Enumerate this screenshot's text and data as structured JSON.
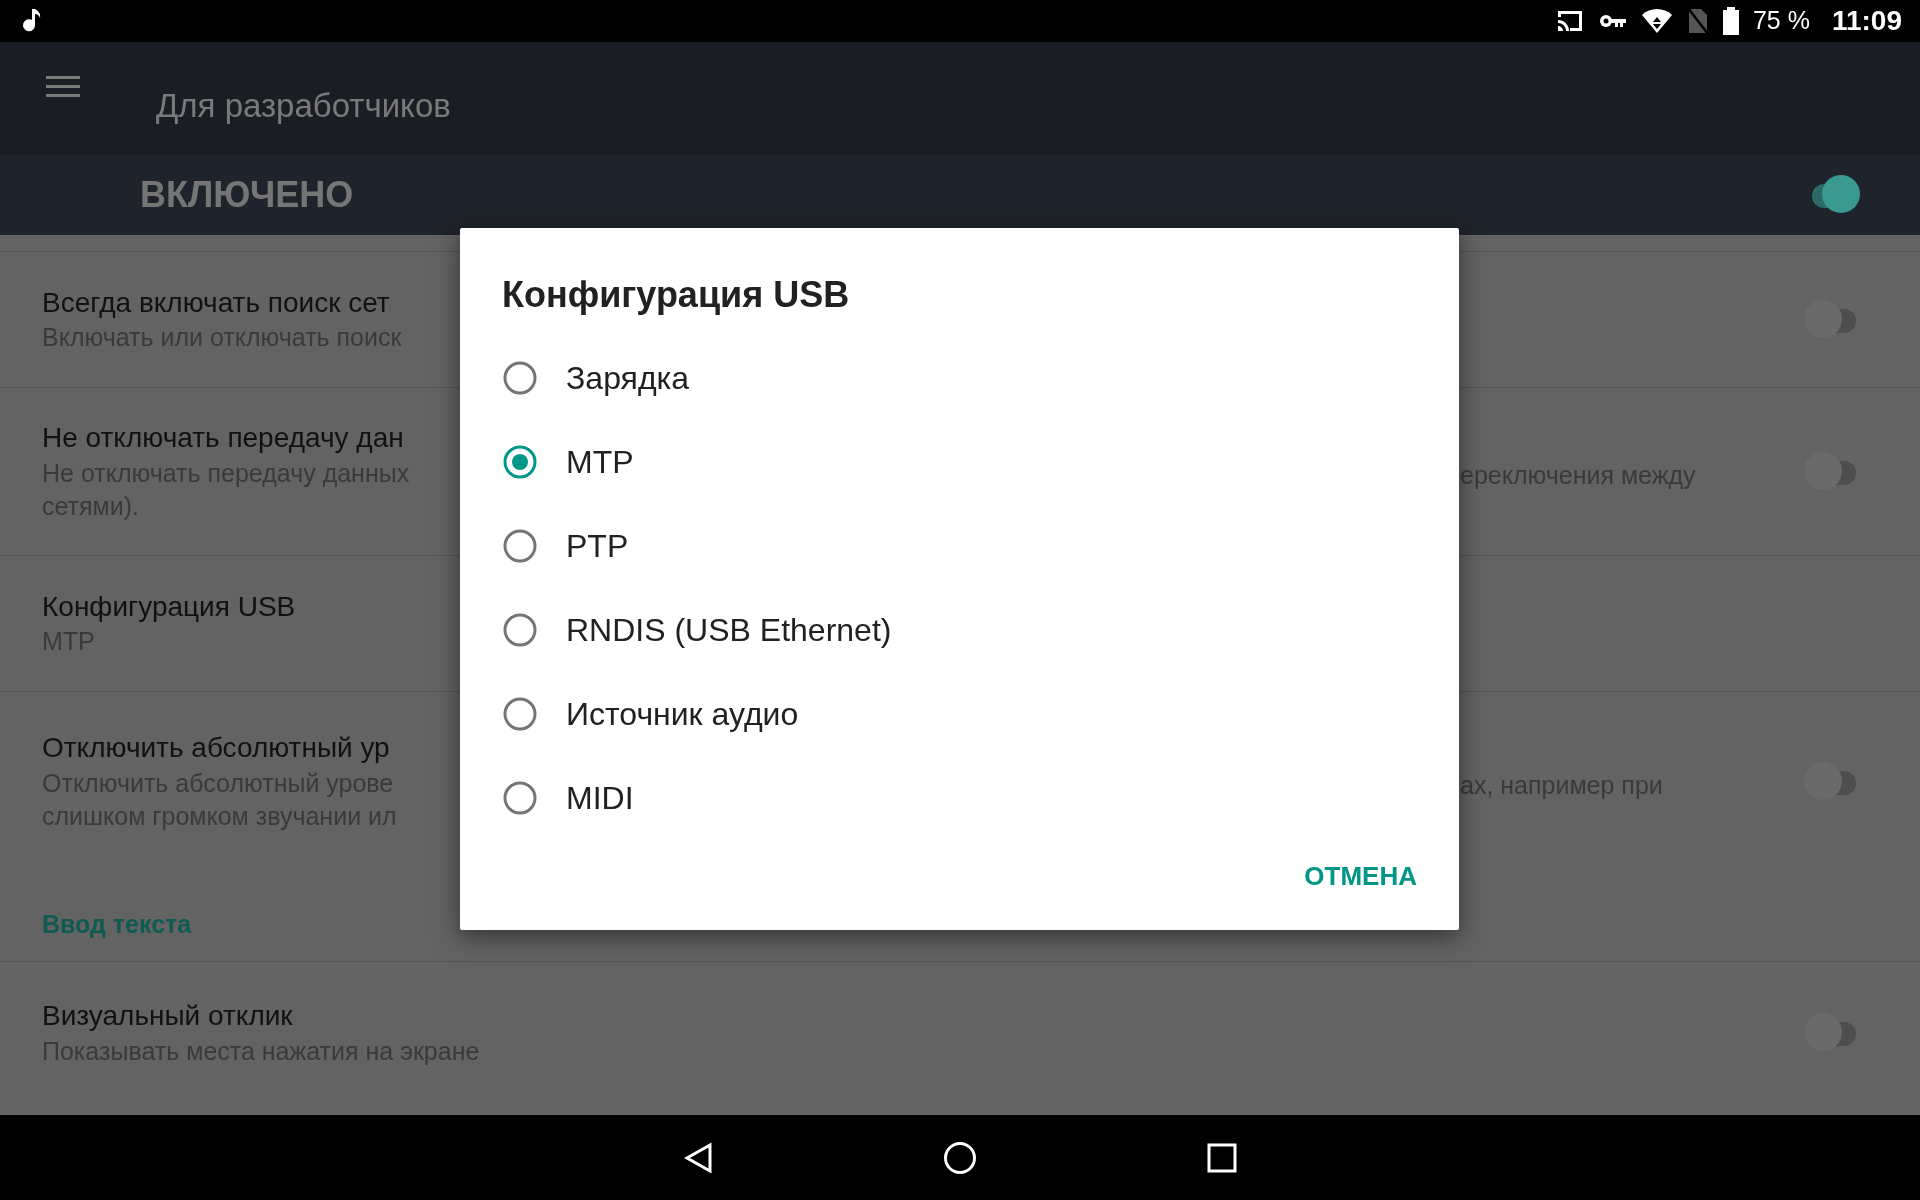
{
  "status_bar": {
    "battery": "75 %",
    "time": "11:09"
  },
  "app_bar": {
    "title": "Для разработчиков"
  },
  "master_switch": {
    "label": "ВКЛЮЧЕНО",
    "on": true
  },
  "settings": [
    {
      "kind": "toggle",
      "title": "Всегда включать поиск сет",
      "summary_lines": [
        "Включать или отключать поиск"
      ],
      "on": false
    },
    {
      "kind": "toggle",
      "title": "Не отключать передачу дан",
      "summary_lines": [
        "Не отключать передачу данных",
        "сетями)."
      ],
      "summary_right": "ереключения между",
      "on": false
    },
    {
      "kind": "plain",
      "title": "Конфигурация USB",
      "summary_lines": [
        "MTP"
      ]
    },
    {
      "kind": "toggle",
      "title": "Отключить абсолютный ур",
      "summary_lines": [
        "Отключить абсолютный урове",
        "слишком громком звучании ил"
      ],
      "summary_right": "ах, например при",
      "on": false
    },
    {
      "kind": "header",
      "title": "Ввод текста"
    },
    {
      "kind": "toggle",
      "title": "Визуальный отклик",
      "summary_lines": [
        "Показывать места нажатия на экране"
      ],
      "on": false
    }
  ],
  "dialog": {
    "title": "Конфигурация USB",
    "options": [
      {
        "label": "Зарядка",
        "selected": false
      },
      {
        "label": "MTP",
        "selected": true
      },
      {
        "label": "PTP",
        "selected": false
      },
      {
        "label": "RNDIS (USB Ethernet)",
        "selected": false
      },
      {
        "label": "Источник аудио",
        "selected": false
      },
      {
        "label": "MIDI",
        "selected": false
      }
    ],
    "buttons": [
      "ОТМЕНА"
    ]
  }
}
